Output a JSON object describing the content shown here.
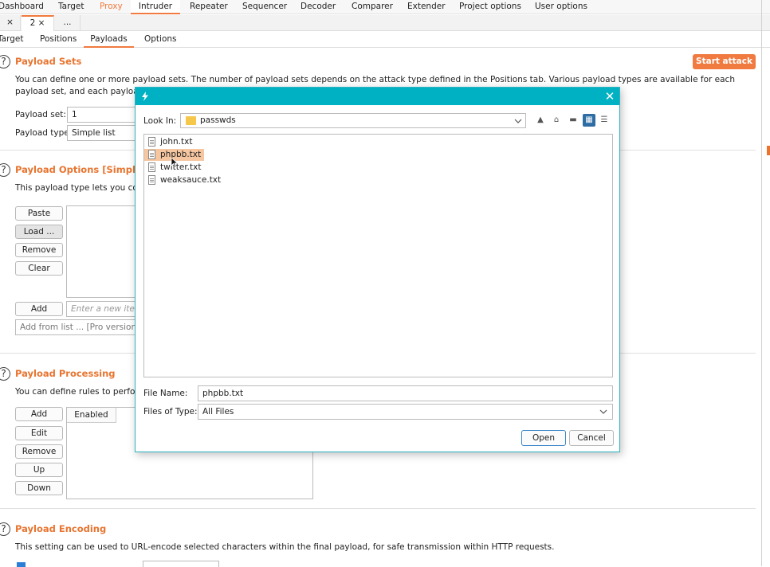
{
  "main_tabs": [
    "Dashboard",
    "Target",
    "Proxy",
    "Intruder",
    "Repeater",
    "Sequencer",
    "Decoder",
    "Comparer",
    "Extender",
    "Project options",
    "User options"
  ],
  "sub_tabs": {
    "close_glyph": "×",
    "tab2": "2 ×",
    "more": "..."
  },
  "inner_tabs": [
    "Target",
    "Positions",
    "Payloads",
    "Options"
  ],
  "start_attack": "Start attack",
  "payload_sets": {
    "title": "Payload Sets",
    "desc_line1": "You can define one or more payload sets. The number of payload sets depends on the attack type defined in the Positions tab. Various payload types are available for each",
    "desc_line2": "payload set, and each payload t",
    "set_label": "Payload set:",
    "set_value": "1",
    "type_label": "Payload type:",
    "type_value": "Simple list"
  },
  "payload_options": {
    "title": "Payload Options [Simple lis",
    "desc": "This payload type lets you confi",
    "buttons": [
      "Paste",
      "Load ...",
      "Remove",
      "Clear"
    ],
    "add": "Add",
    "add_placeholder": "Enter a new item",
    "add_from_list": "Add from list ... [Pro version or"
  },
  "payload_processing": {
    "title": "Payload Processing",
    "desc": "You can define rules to perform",
    "buttons": [
      "Add",
      "Edit",
      "Remove",
      "Up",
      "Down"
    ],
    "col_enabled": "Enabled"
  },
  "payload_encoding": {
    "title": "Payload Encoding",
    "desc": "This setting can be used to URL-encode selected characters within the final payload, for safe transmission within HTTP requests."
  },
  "dialog": {
    "look_in_label": "Look In:",
    "look_in_value": "passwds",
    "files": [
      "john.txt",
      "phpbb.txt",
      "twitter.txt",
      "weaksauce.txt"
    ],
    "selected_index": 1,
    "file_name_label": "File Name:",
    "file_name_value": "phpbb.txt",
    "files_of_type_label": "Files of Type:",
    "files_of_type_value": "All Files",
    "open": "Open",
    "cancel": "Cancel"
  },
  "colors": {
    "accent": "#f07a3f",
    "dialog_title": "#00b1c3",
    "selection": "#f6c6a0"
  }
}
